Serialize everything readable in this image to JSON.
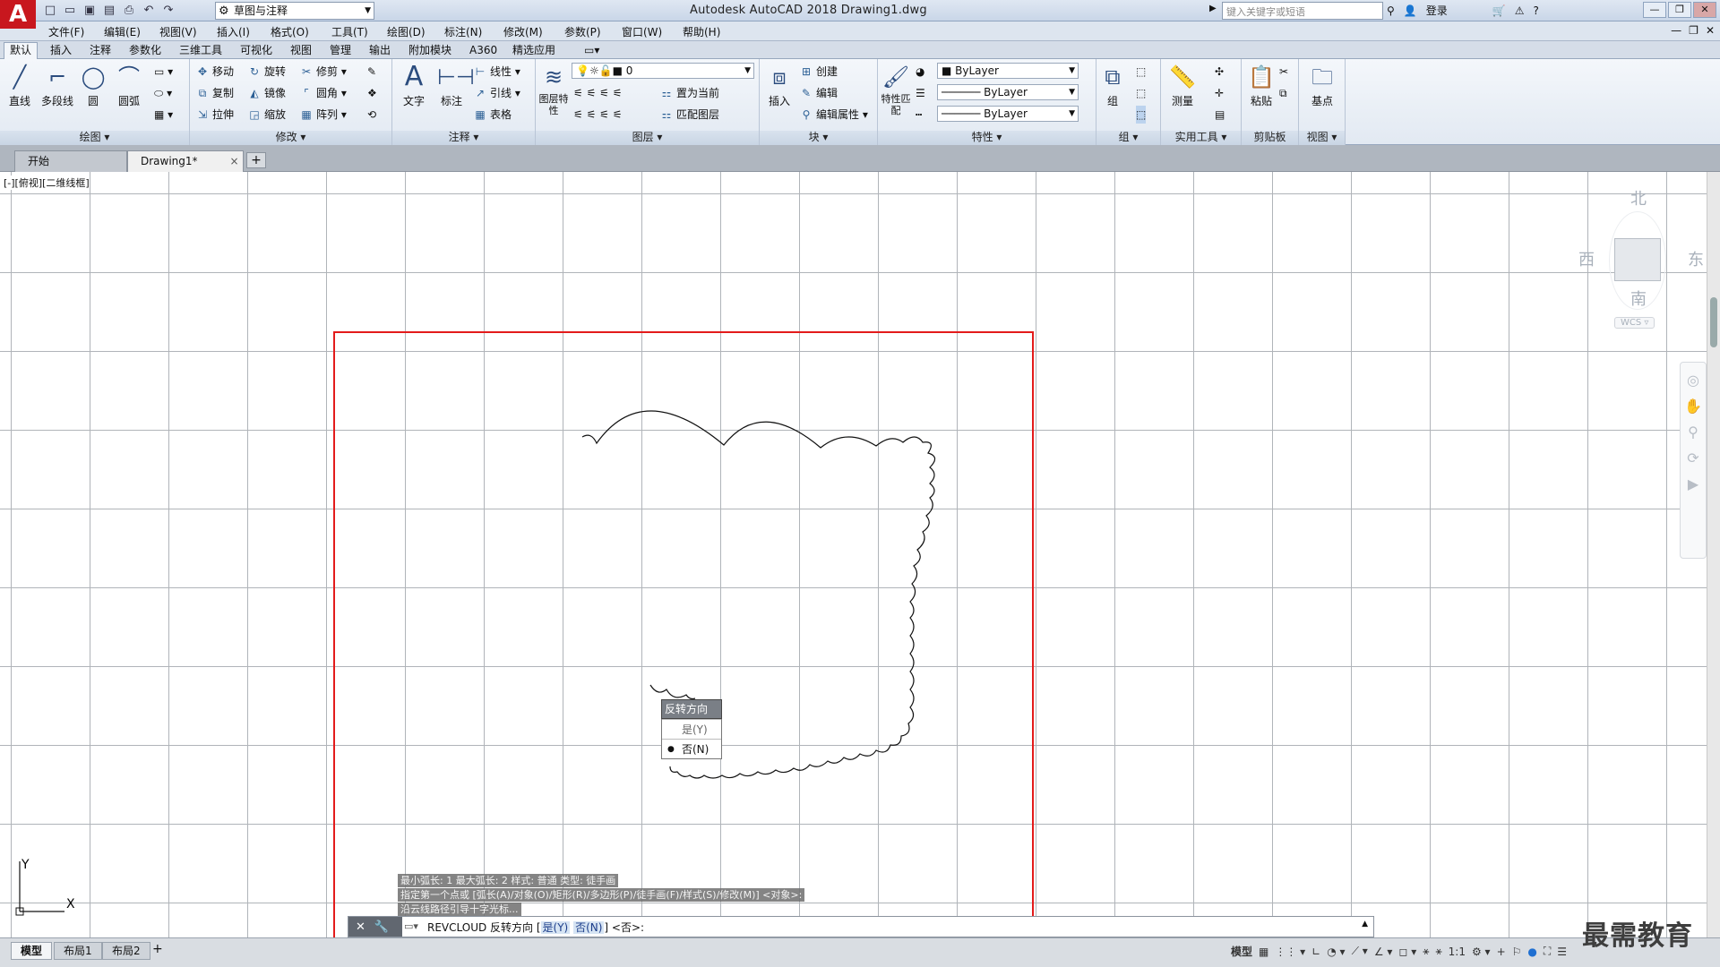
{
  "app": {
    "logo": "A",
    "title": "Autodesk AutoCAD 2018   Drawing1.dwg"
  },
  "qat": {
    "icons": [
      "new-icon",
      "open-icon",
      "save-icon",
      "saveas-icon",
      "plot-icon",
      "undo-icon",
      "redo-icon"
    ],
    "workspace": "草图与注释"
  },
  "search": {
    "placeholder": "键入关键字或短语",
    "login": "登录"
  },
  "menu": [
    "文件(F)",
    "编辑(E)",
    "视图(V)",
    "插入(I)",
    "格式(O)",
    "工具(T)",
    "绘图(D)",
    "标注(N)",
    "修改(M)",
    "参数(P)",
    "窗口(W)",
    "帮助(H)"
  ],
  "ribbon_tabs": [
    "默认",
    "插入",
    "注释",
    "参数化",
    "三维工具",
    "可视化",
    "视图",
    "管理",
    "输出",
    "附加模块",
    "A360",
    "精选应用"
  ],
  "ribbon": {
    "draw": {
      "title": "绘图",
      "line": "直线",
      "polyline": "多段线",
      "circle": "圆",
      "arc": "圆弧"
    },
    "modify": {
      "title": "修改",
      "move": "移动",
      "rotate": "旋转",
      "trim": "修剪",
      "copy": "复制",
      "mirror": "镜像",
      "fillet": "圆角",
      "stretch": "拉伸",
      "scale": "缩放",
      "array": "阵列"
    },
    "annotation": {
      "title": "注释",
      "text": "文字",
      "dim": "标注",
      "linear": "线性",
      "leader": "引线",
      "table": "表格"
    },
    "layers": {
      "title": "图层",
      "props": "图层特性",
      "current_layer": "0",
      "make_current": "置为当前",
      "match": "匹配图层"
    },
    "block": {
      "title": "块",
      "insert": "插入",
      "create": "创建",
      "edit": "编辑",
      "edit_attr": "编辑属性"
    },
    "properties": {
      "title": "特性",
      "match": "特性匹配",
      "color": "ByLayer",
      "linetype": "ByLayer",
      "lineweight": "ByLayer"
    },
    "group": {
      "title": "组",
      "label": "组"
    },
    "utilities": {
      "title": "实用工具",
      "measure": "测量"
    },
    "clipboard": {
      "title": "剪贴板",
      "paste": "粘贴"
    },
    "view": {
      "title": "视图",
      "base": "基点"
    }
  },
  "file_tabs": {
    "start": "开始",
    "drawing": "Drawing1*",
    "close": "×",
    "plus": "+"
  },
  "viewport": {
    "label": "[-][俯视][二维线框]"
  },
  "viewcube": {
    "north": "北",
    "south": "南",
    "east": "东",
    "west": "西",
    "wcs": "WCS ▿"
  },
  "ucs": {
    "x": "X",
    "y": "Y"
  },
  "context_menu": {
    "title": "反转方向",
    "items": [
      {
        "label": "是(Y)",
        "selected": false
      },
      {
        "label": "否(N)",
        "selected": true
      }
    ]
  },
  "command": {
    "history": [
      "最小弧长: 1    最大弧长: 2    样式: 普通    类型: 徒手画",
      "指定第一个点或 [弧长(A)/对象(O)/矩形(R)/多边形(P)/徒手画(F)/样式(S)/修改(M)] <对象>:",
      "沿云线路径引导十字光标..."
    ],
    "prompt_prefix": "REVCLOUD 反转方向 [",
    "opt_yes": "是(Y)",
    "opt_no": "否(N)",
    "prompt_suffix": "] <否>:"
  },
  "layouts": [
    "模型",
    "布局1",
    "布局2"
  ],
  "status": {
    "model": "模型",
    "scale": "1:1"
  },
  "watermark": "最需教育",
  "colors": {
    "selection_border": "#e31b1b",
    "logo_red": "#c8171e"
  }
}
